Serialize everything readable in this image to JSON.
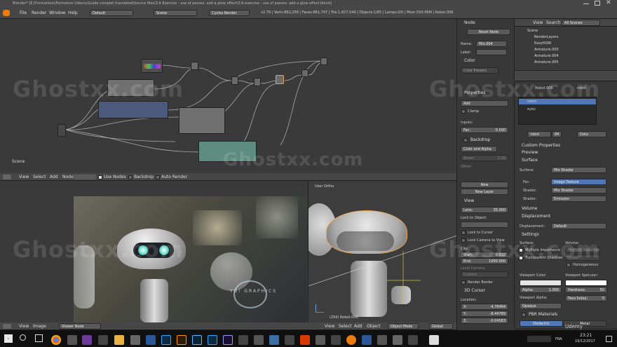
{
  "window": {
    "title": "Blender* [E:\\Formations\\Formation Udemy\\Guide complet translated\\Source files\\3.6-Exercise - use of passes: add a glow effect\\3.6-exercise - use of passes: add a glow effect.blend]"
  },
  "topbar": {
    "menus": [
      "File",
      "Render",
      "Window",
      "Help"
    ],
    "layout": "Default",
    "scene": "Scene",
    "engine": "Cycles Render",
    "stats": "v2.79 | Verts:862,258 | Faces:861,797 | Tris:1,827,544 | Objects:1/65 | Lamps:0/0 | Mem:550.06M | Robot.006"
  },
  "node_editor": {
    "label": "Scene",
    "header": [
      "View",
      "Select",
      "Add",
      "Node"
    ],
    "use_nodes": "Use Nodes",
    "backdrop": "Backdrop",
    "auto_render": "Auto Render"
  },
  "node_props": {
    "section_node": "Node",
    "reset_node": "Reset Node",
    "name_label": "Name:",
    "name_value": "Mix.004",
    "label_label": "Label:",
    "section_color": "Color",
    "color_presets": "Color Presets",
    "section_properties": "Properties",
    "blend": "Add",
    "clamp": "Clamp",
    "inputs": "Inputs:",
    "fac_label": "Fac:",
    "fac_value": "0.500",
    "section_backdrop": "Backdrop",
    "color_alpha": "Color and Alpha",
    "zoom_label": "Zoom:",
    "zoom_value": "1.00",
    "offset": "Offset:"
  },
  "outliner": {
    "header": [
      "View",
      "Search"
    ],
    "filter": "All Scenes",
    "rows": [
      "Scene",
      "RenderLayers",
      "EasyHDRI",
      "Armature.003",
      "Armature.004",
      "Armature.005"
    ]
  },
  "material": {
    "object": "Robot.006",
    "sub": "robot",
    "slots": [
      "robot",
      "eyes"
    ],
    "mat_name": "robot",
    "users": "84",
    "data": "Data",
    "sections": {
      "custom": "Custom Properties",
      "preview": "Preview",
      "surface": "Surface",
      "volume": "Volume",
      "displacement": "Displacement",
      "settings": "Settings",
      "pbr": "PBR Materials"
    },
    "surface_label": "Surface:",
    "surface_value": "Mix Shader",
    "fac_label": "Fac:",
    "fac_value": "Image Texture",
    "shader1_label": "Shader:",
    "shader1_value": "Mix Shader",
    "shader2_label": "Shader:",
    "shader2_value": "Emission",
    "disp_label": "Displacement:",
    "disp_value": "Default",
    "set_surface": "Surface:",
    "set_volume": "Volume:",
    "multiple_importance": "Multiple Importance",
    "transparent_shadows": "Transparent Shadows",
    "vol_multiple": "Multiple Importance",
    "vol_linear": "Linear",
    "homogeneous": "Homogeneous",
    "viewport_color": "Viewport Color:",
    "viewport_specular": "Viewport Specular:",
    "alpha_label": "Alpha:",
    "alpha_value": "1.000",
    "hardness_label": "Hardness:",
    "hardness_value": "50",
    "viewport_alpha": "Viewport Alpha:",
    "opaque": "Opaque",
    "pass_index": "Pass Index:",
    "pass_value": "0",
    "dielectric": "Dielectric",
    "metal": "Metal"
  },
  "image_editor": {
    "header": [
      "View",
      "Image"
    ],
    "image_name": "Viewer Node",
    "overlay_text": "YO! GRAPHICS"
  },
  "viewport": {
    "label": "User Ortho",
    "object": "(250) Robot.006",
    "header": [
      "View",
      "Select",
      "Add",
      "Object"
    ],
    "mode": "Object Mode",
    "orientation": "Global"
  },
  "view_props": {
    "new": "New",
    "new_layer": "New Layer",
    "section_view": "View",
    "lens_label": "Lens:",
    "lens_value": "35.000",
    "lock_object": "Lock to Object:",
    "lock_cursor": "Lock to Cursor",
    "lock_camera": "Lock Camera to View",
    "clip": "Clip:",
    "start_label": "Start:",
    "start_value": "0.010",
    "end_label": "End:",
    "end_value": "1000.000",
    "local_camera": "Local Camera:",
    "camera": "Camera",
    "render_border": "Render Border",
    "section_cursor": "3D Cursor",
    "location": "Location:",
    "x_label": "X:",
    "x_value": "-4.78464",
    "y_label": "Y:",
    "y_value": "-8.44789",
    "z_label": "Z:",
    "z_value": "-0.04583"
  },
  "taskbar": {
    "lang": "FRA",
    "time": "23:21",
    "date": "19/12/2017",
    "udemy": "Udemy"
  },
  "watermark": "Ghostxx.com",
  "colors": {
    "bg": "#303030",
    "header": "#474747",
    "accent_blue": "#5177b7",
    "taskbar": "#101010"
  }
}
